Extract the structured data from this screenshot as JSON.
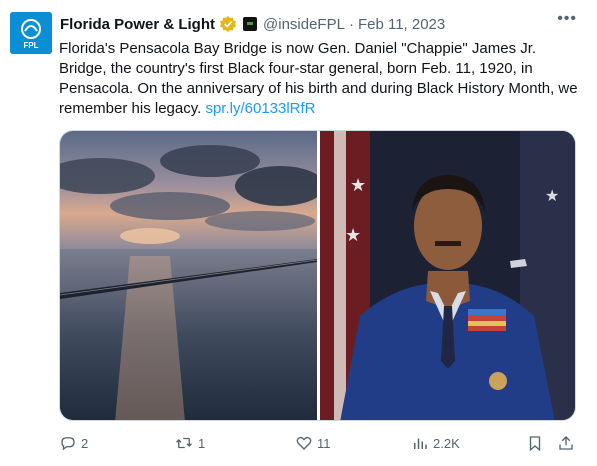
{
  "account": {
    "name": "Florida Power & Light",
    "handle": "@insideFPL",
    "separator": "·",
    "date": "Feb 11, 2023",
    "avatar_text": "FPL"
  },
  "menu": {
    "more_label": "•••"
  },
  "tweet": {
    "body": "Florida's Pensacola Bay Bridge is now Gen. Daniel \"Chappie\" James Jr. Bridge, the country's first Black four-star general, born Feb. 11, 1920, in Pensacola.  On the anniversary of his birth and during Black History Month, we remember his legacy.",
    "link": "spr.ly/60133lRfR"
  },
  "media": {
    "left_icon": "bridge-sunset-photo",
    "right_icon": "general-portrait-photo"
  },
  "actions": {
    "replies": "2",
    "retweets": "1",
    "likes": "11",
    "views": "2.2K"
  },
  "colors": {
    "link": "#1d9bf0",
    "muted": "#536471",
    "brand": "#0a8fd4",
    "verified": "#e2b719"
  }
}
